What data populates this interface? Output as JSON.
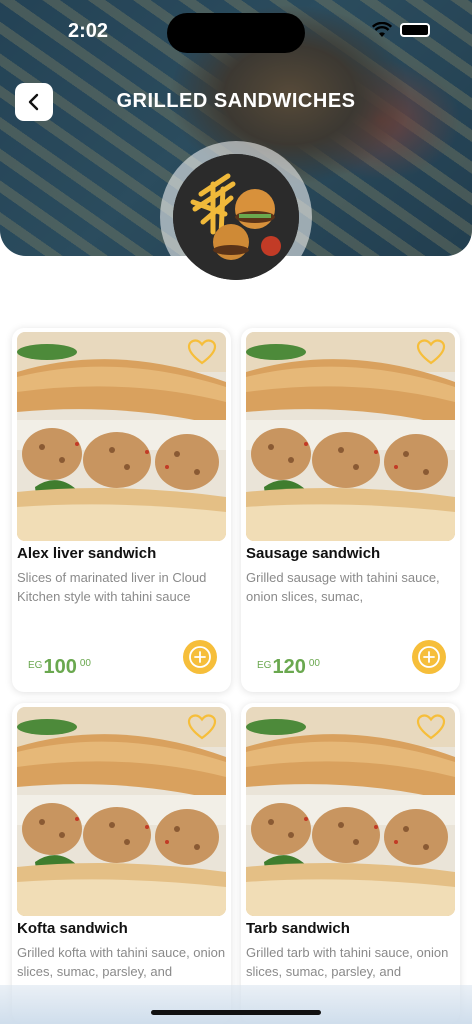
{
  "status_bar": {
    "time": "2:02"
  },
  "header": {
    "title": "GRILLED SANDWICHES"
  },
  "products": [
    {
      "name": "Alex liver sandwich",
      "description": "Slices of marinated liver in Cloud Kitchen style with tahini sauce",
      "currency": "EG",
      "price_int": "100",
      "price_dec": "00"
    },
    {
      "name": "Sausage sandwich",
      "description": "Grilled sausage with tahini sauce, onion slices, sumac,",
      "currency": "EG",
      "price_int": "120",
      "price_dec": "00"
    },
    {
      "name": "Kofta sandwich",
      "description": "Grilled kofta with tahini sauce, onion slices, sumac, parsley, and",
      "currency": "",
      "price_int": "",
      "price_dec": ""
    },
    {
      "name": "Tarb sandwich",
      "description": "Grilled tarb with tahini sauce, onion slices, sumac, parsley, and",
      "currency": "",
      "price_int": "",
      "price_dec": ""
    }
  ],
  "colors": {
    "accent": "#f6be3a",
    "price": "#6aa84f"
  },
  "icons": {
    "back": "chevron-left-icon",
    "favorite": "heart-outline-icon",
    "add": "plus-circle-icon"
  }
}
